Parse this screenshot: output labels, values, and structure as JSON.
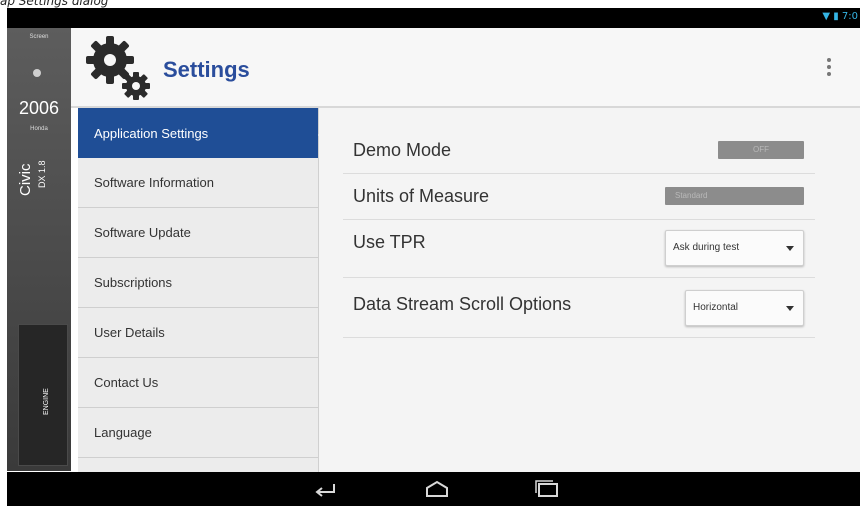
{
  "caption": "ap Settings dialog",
  "status_bar": {
    "time": "7:0"
  },
  "vehicle": {
    "screen_label": "Screen",
    "year": "2006",
    "make": "Honda",
    "model": "Civic",
    "trim": "DX 1.8",
    "engine_label": "ENGINE"
  },
  "header": {
    "title": "Settings"
  },
  "sidebar": {
    "items": [
      {
        "label": "Application Settings"
      },
      {
        "label": "Software Information"
      },
      {
        "label": "Software Update"
      },
      {
        "label": "Subscriptions"
      },
      {
        "label": "User Details"
      },
      {
        "label": "Contact Us"
      },
      {
        "label": "Language"
      }
    ]
  },
  "settings": {
    "demo_mode": {
      "label": "Demo Mode",
      "value": "OFF"
    },
    "units": {
      "label": "Units of Measure",
      "value": "Standard"
    },
    "tpr": {
      "label": "Use TPR",
      "value": "Ask during test"
    },
    "scroll": {
      "label": "Data Stream Scroll Options",
      "value": "Horizontal"
    }
  },
  "colors": {
    "accent": "#1f4e96",
    "title": "#2a4d9c",
    "status_icon": "#35b5e5"
  },
  "icons": [
    "settings-gears-icon",
    "overflow-menu-icon",
    "back-icon",
    "home-icon",
    "recent-apps-icon",
    "wifi-icon",
    "battery-icon"
  ]
}
